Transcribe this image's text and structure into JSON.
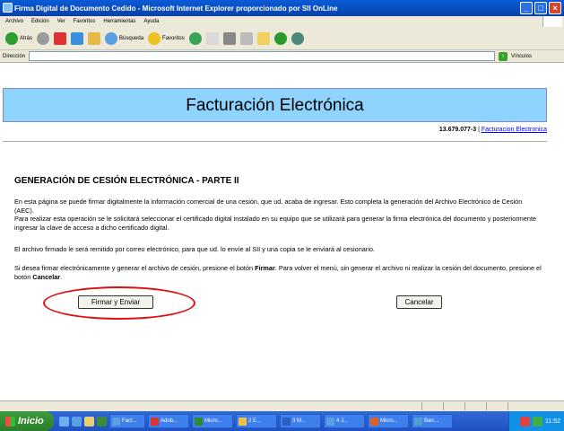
{
  "window": {
    "title": "Firma Digital de Documento Cedido - Microsoft Internet Explorer proporcionado por SII OnLine",
    "controls": [
      "_",
      "□",
      "×"
    ]
  },
  "menu": [
    "Archivo",
    "Edición",
    "Ver",
    "Favoritos",
    "Herramientas",
    "Ayuda"
  ],
  "toolbar": {
    "back_label": "Atrás",
    "search_label": "Búsqueda",
    "favorites_label": "Favoritos"
  },
  "address": {
    "label": "Dirección",
    "value": "",
    "links_label": "Vínculos"
  },
  "page": {
    "header_title": "Facturación Electrónica",
    "rut": "13.679.077-3",
    "separator": " | ",
    "header_link": "Facturacion Electronica",
    "section_title": "GENERACIÓN DE CESIÓN ELECTRÓNICA - PARTE II",
    "para1": "En esta página se puede firmar digitalmente la información comercial de una cesión, que ud. acaba de ingresar. Esto completa la generación del Archivo Electrónico de Cesión (AEC).",
    "para2": "Para realizar esta operación se le solicitará seleccionar el certificado digital instalado en su equipo que se utilizará para generar la firma electrónica del documento y posteriormente ingresar la clave de acceso a dicho certificado digital.",
    "para3": "El archivo firmado le será remitido por correo electrónico, para que ud. lo envíe al SII y una copia se le enviará al cesionario.",
    "para4_a": "Si desea firmar electrónicamente y generar el archivo de cesión, presione el botón ",
    "para4_b": "Firmar",
    "para4_c": ". Para volver el menú, sin generar el archivo ni realizar la cesión del documento, presione el botón ",
    "para4_d": "Cancelar",
    "para4_e": ".",
    "sign_button": "Firmar y Enviar",
    "cancel_button": "Cancelar"
  },
  "taskbar": {
    "start_label": "Inicio",
    "tasks": [
      "Fact...",
      "Adob...",
      "Micro...",
      "2 E...",
      "3 M...",
      "4 J...",
      "Micro...",
      "Barr..."
    ],
    "clock": "11:52"
  },
  "colors": {
    "header_band": "#8fd4ff",
    "highlight_ellipse": "#e01010",
    "link": "#0000ff"
  }
}
